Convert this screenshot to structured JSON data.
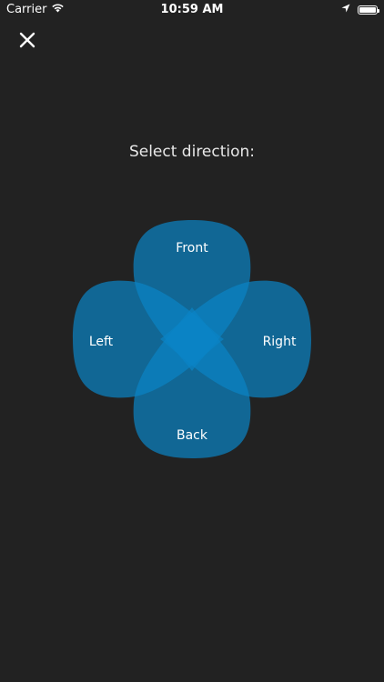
{
  "status_bar": {
    "carrier": "Carrier",
    "time": "10:59 AM",
    "battery_level": 1.0,
    "icons": [
      "wifi-icon",
      "location-arrow-icon",
      "battery-icon"
    ]
  },
  "header": {
    "close_icon": "close-icon"
  },
  "prompt": "Select direction:",
  "directions": {
    "front": "Front",
    "left": "Left",
    "right": "Right",
    "back": "Back"
  },
  "colors": {
    "background": "#222222",
    "petal": "#0a84c6",
    "text": "#ffffff"
  }
}
